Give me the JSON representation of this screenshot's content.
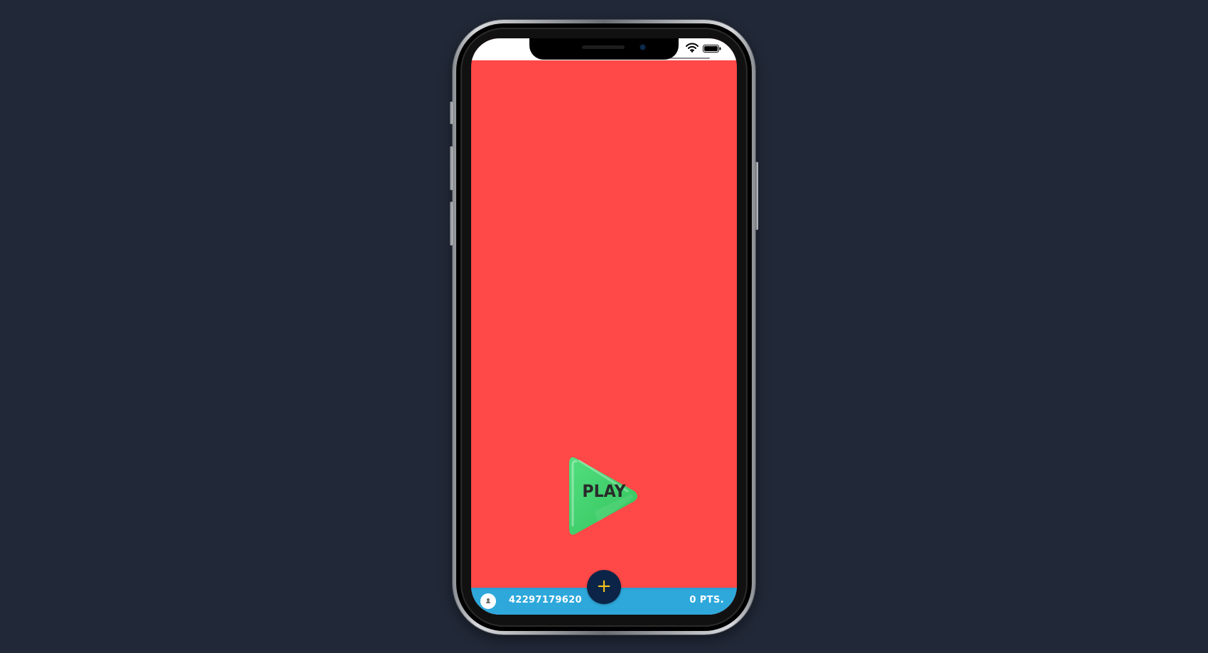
{
  "app": {
    "background_color": "#212837",
    "screen_color": "#ff4848"
  },
  "status_bar": {
    "wifi_icon": "wifi-icon",
    "battery_icon": "battery-icon"
  },
  "main": {
    "play_button": {
      "label": "PLAY",
      "icon": "play-triangle-icon",
      "color": "#3dd36a"
    }
  },
  "bottom_bar": {
    "color": "#2ea8db",
    "avatar_icon": "user-icon",
    "user_id": "42297179620",
    "points": "0 PTS.",
    "add_button": {
      "label": "+",
      "color": "#0b2447",
      "accent": "#f2c21b"
    }
  }
}
